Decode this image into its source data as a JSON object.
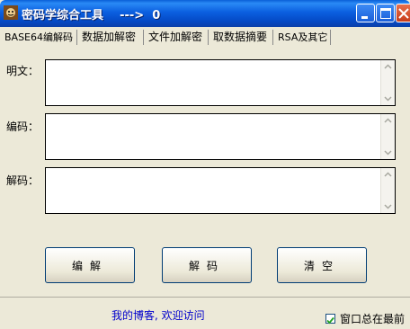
{
  "window": {
    "title": "密码学综合工具    --->  0",
    "icons": {
      "app": "app-icon",
      "minimize": "minimize-icon",
      "maximize": "maximize-icon",
      "close": "close-icon"
    }
  },
  "tabs": [
    {
      "label": "BASE64编解码",
      "active": true
    },
    {
      "label": "数据加解密",
      "active": false
    },
    {
      "label": "文件加解密",
      "active": false
    },
    {
      "label": "取数据摘要",
      "active": false
    },
    {
      "label": "RSA及其它",
      "active": false
    }
  ],
  "fields": {
    "plaintext_label": "明文：",
    "encoded_label": "编码：",
    "decoded_label": "解码：",
    "plaintext_value": "",
    "encoded_value": "",
    "decoded_value": ""
  },
  "buttons": {
    "encode": "编解",
    "decode": "解码",
    "clear": "清空"
  },
  "status": {
    "blog_link": "我的博客, 欢迎访问",
    "ontop_label": "窗口总在最前",
    "ontop_checked": true
  },
  "colors": {
    "titlebar": "#0b5fe0",
    "window_bg": "#ece9d8",
    "link": "#0000cc",
    "close_button": "#d9532a"
  }
}
